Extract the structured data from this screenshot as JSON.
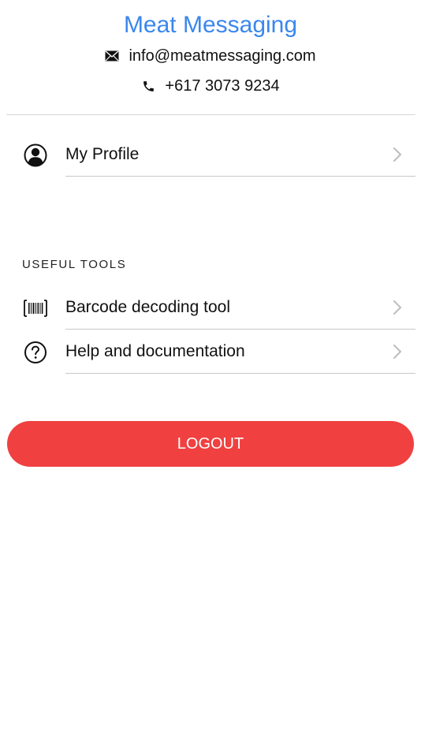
{
  "header": {
    "title": "Meat Messaging",
    "email": "info@meatmessaging.com",
    "phone": "+617 3073 9234"
  },
  "profile": {
    "label": "My Profile",
    "icon": "person-circle-icon"
  },
  "tools": {
    "section_title": "USEFUL TOOLS",
    "items": [
      {
        "label": "Barcode decoding tool",
        "icon": "barcode-icon"
      },
      {
        "label": "Help and documentation",
        "icon": "question-circle-icon"
      }
    ]
  },
  "logout": {
    "label": "LOGOUT"
  },
  "colors": {
    "title": "#3a87ee",
    "logout_bg": "#f04040",
    "chevron": "#bdbdbd"
  }
}
